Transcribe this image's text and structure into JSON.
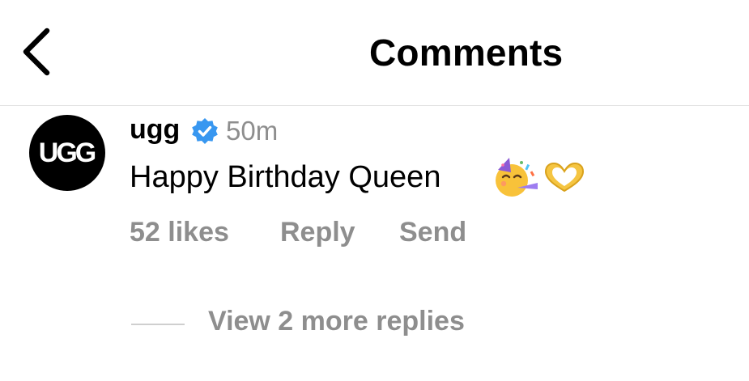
{
  "header": {
    "title": "Comments",
    "back_icon": "chevron-left-icon"
  },
  "comment": {
    "avatar_text": "UGG",
    "username": "ugg",
    "verified_icon": "verified-badge-icon",
    "verified_color": "#3897f0",
    "time": "50m",
    "text": "Happy Birthday Queen",
    "emojis": [
      "partying-face-emoji",
      "heart-hands-emoji"
    ],
    "likes": "52 likes",
    "reply_label": "Reply",
    "send_label": "Send"
  },
  "replies": {
    "label": "View 2 more replies"
  }
}
